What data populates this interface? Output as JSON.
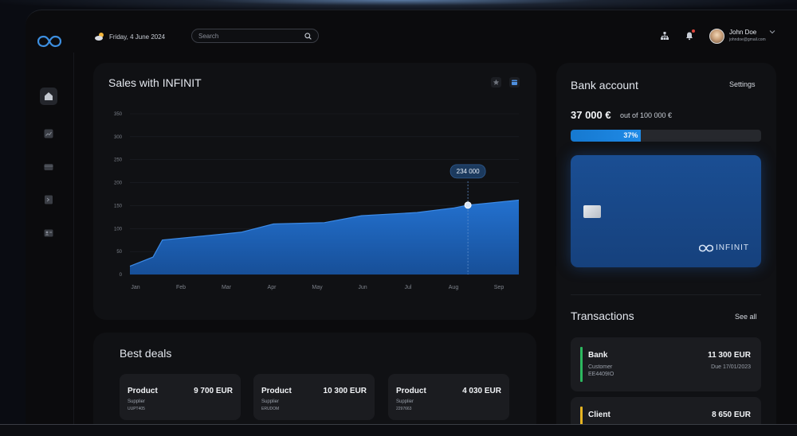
{
  "header": {
    "date": "Friday, 4 June 2024",
    "search_placeholder": "Search",
    "user": {
      "name": "John Doe",
      "email": "johndoe@gmail.com"
    }
  },
  "sidebar": {
    "items": [
      {
        "icon": "home-icon",
        "active": true
      },
      {
        "icon": "chart-icon",
        "active": false
      },
      {
        "icon": "card-icon",
        "active": false
      },
      {
        "icon": "file-icon",
        "active": false
      },
      {
        "icon": "contact-icon",
        "active": false
      }
    ]
  },
  "sales": {
    "title": "Sales with INFINIT",
    "tooltip": "234 000"
  },
  "chart_data": {
    "type": "area",
    "title": "Sales with INFINIT",
    "xlabel": "",
    "ylabel": "",
    "x_ticks": [
      "Jan",
      "Feb",
      "Mar",
      "Apr",
      "May",
      "Jun",
      "Jul",
      "Aug",
      "Sep"
    ],
    "y_ticks": [
      "0",
      "50",
      "100",
      "150",
      "200",
      "250",
      "300",
      "350"
    ],
    "ylim": [
      0,
      350
    ],
    "grid": true,
    "series": [
      {
        "x": [
          0,
          0.5,
          0.7,
          1.5,
          2.4,
          3.1,
          4.2,
          5.0,
          6.2,
          7.0,
          7.3,
          8.4
        ],
        "values": [
          18,
          38,
          75,
          83,
          92,
          110,
          113,
          128,
          135,
          145,
          151,
          162
        ]
      }
    ],
    "highlight": {
      "x": 7.3,
      "value": 151,
      "label": "234 000"
    },
    "color": "#1e63b8"
  },
  "deals": {
    "title": "Best deals",
    "items": [
      {
        "name": "Product",
        "price": "9 700 EUR",
        "role": "Supplier",
        "code": "UUPT405"
      },
      {
        "name": "Product",
        "price": "10 300 EUR",
        "role": "Supplier",
        "code": "ERUDOM"
      },
      {
        "name": "Product",
        "price": "4 030 EUR",
        "role": "Supplier",
        "code": "2297663"
      }
    ]
  },
  "bank": {
    "title": "Bank account",
    "settings": "Settings",
    "amount": "37 000 €",
    "amount_of": "out of 100 000 €",
    "progress": 0.37,
    "progress_label": "37%",
    "card_brand": "INFINIT"
  },
  "transactions": {
    "title": "Transactions",
    "see_all": "See all",
    "items": [
      {
        "name": "Bank",
        "amount": "11 300 EUR",
        "role": "Customer",
        "id": "EE4409IO",
        "due": "Due 17/01/2023",
        "color": "#2db85f"
      },
      {
        "name": "Client",
        "amount": "8 650 EUR",
        "role": "",
        "id": "",
        "due": "",
        "color": "#e6b422"
      }
    ]
  }
}
